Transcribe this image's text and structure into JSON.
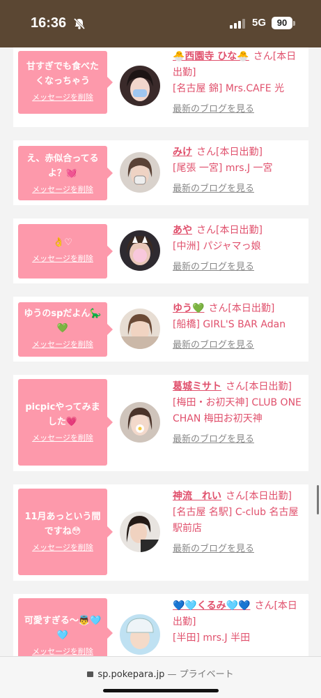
{
  "status": {
    "time": "16:36",
    "network": "5G",
    "battery": "90"
  },
  "messages": [
    {
      "text": "甘すぎでも食べたくなっちゃう",
      "delete": "メッセージを削除",
      "name": "🐣西園寺 ひな🐣",
      "honorific": "さん[本日出勤]",
      "shop": "[名古屋 錦] Mrs.CAFE 光",
      "blog": "最新のブログを見る"
    },
    {
      "text": "え、赤似合ってるよ？💓",
      "delete": "メッセージを削除",
      "name": "みけ",
      "honorific": "さん[本日出勤]",
      "shop": "[尾張 一宮] mrs.J 一宮",
      "blog": "最新のブログを見る"
    },
    {
      "text": "👌♡",
      "delete": "メッセージを削除",
      "name": "あや",
      "honorific": "さん[本日出勤]",
      "shop": "[中洲] パジャマっ娘",
      "blog": "最新のブログを見る"
    },
    {
      "text": "ゆうのspだよん🦕💚",
      "delete": "メッセージを削除",
      "name": "ゆう💚",
      "honorific": "さん[本日出勤]",
      "shop": "[船橋] GIRL'S BAR Adan",
      "blog": "最新のブログを見る"
    },
    {
      "text": "picpicやってみました💗",
      "delete": "メッセージを削除",
      "name": "葛城ミサト",
      "honorific": "さん[本日出勤]",
      "shop": "[梅田・お初天神] CLUB ONE CHAN 梅田お初天神",
      "blog": "最新のブログを見る"
    },
    {
      "text": "11月あっという間ですね😳",
      "delete": "メッセージを削除",
      "name": "神流　れい",
      "honorific": "さん[本日出勤]",
      "shop": "[名古屋 名駅] C-club 名古屋駅前店",
      "blog": "最新のブログを見る"
    },
    {
      "text": "可愛すぎる〜👼🩵🩵",
      "delete": "メッセージを削除",
      "name": "💙🩵くるみ🩵💙",
      "honorific": "さん[本日出勤]",
      "shop": "[半田] mrs.J 半田",
      "blog": ""
    }
  ],
  "browser": {
    "url": "sp.pokepara.jp",
    "separator": "—",
    "mode": "プライベート"
  }
}
